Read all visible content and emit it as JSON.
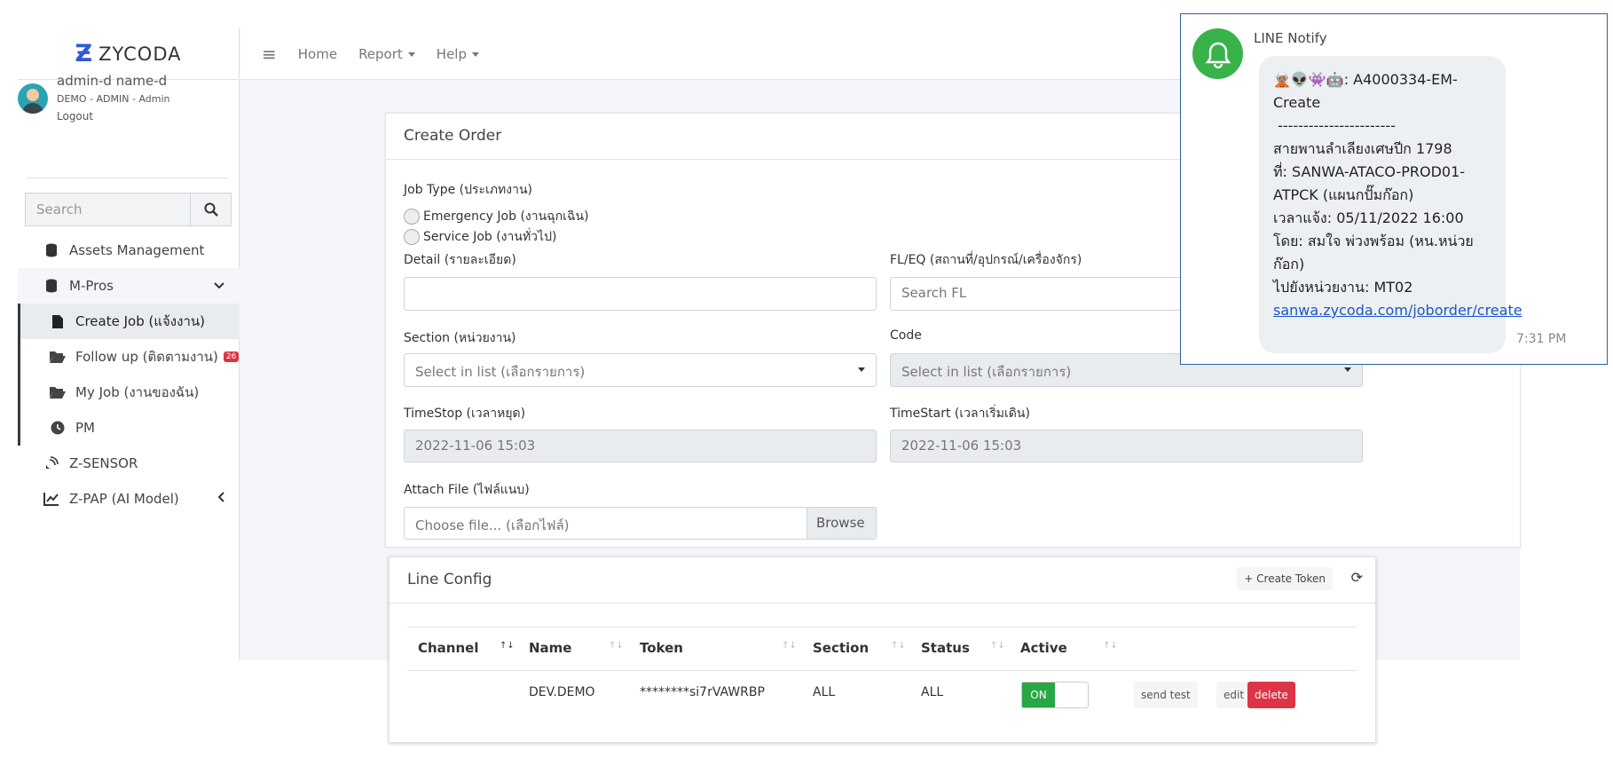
{
  "brand": {
    "name": "ZYCODA"
  },
  "user": {
    "name": "admin-d name-d",
    "role": "DEMO - ADMIN - Admin",
    "logout": "Logout"
  },
  "search": {
    "placeholder": "Search"
  },
  "nav": [
    {
      "label": "Assets Management",
      "icon": "database-icon"
    },
    {
      "label": "M-Pros",
      "icon": "database-icon"
    },
    {
      "label": "Create Job (แจ้งงาน)",
      "icon": "file-icon"
    },
    {
      "label": "Follow up (ติดตามงาน)",
      "icon": "folder-open-icon",
      "badge": "26"
    },
    {
      "label": "My Job (งานของฉัน)",
      "icon": "folder-open-icon"
    },
    {
      "label": "PM",
      "icon": "clock-icon"
    },
    {
      "label": "Z-SENSOR",
      "icon": "satellite-dish-icon"
    },
    {
      "label": "Z-PAP (AI Model)",
      "icon": "chart-line-icon"
    }
  ],
  "topnav": {
    "home": "Home",
    "report": "Report",
    "help": "Help"
  },
  "order": {
    "title": "Create Order",
    "job_type": "Job Type (ประเภทงาน)",
    "emergency": "Emergency Job (งานฉุกเฉิน)",
    "service": "Service Job (งานทั่วไป)",
    "detail": "Detail (รายละเอียด)",
    "fleq": "FL/EQ (สถานที่/อุปกรณ์/เครื่องจักร)",
    "fl_placeholder": "Search FL",
    "section": "Section (หน่วยงาน)",
    "section_value": "Select in list (เลือกรายการ)",
    "code": "Code",
    "code_value": "Select in list (เลือกรายการ)",
    "timestop": "TimeStop (เวลาหยุด)",
    "timestop_value": "2022-11-06 15:03",
    "timestart": "TimeStart (เวลาเริ่มเดิน)",
    "timestart_value": "2022-11-06 15:03",
    "attach": "Attach File (ไฟล์แนบ)",
    "file_placeholder": "Choose file... (เลือกไฟล์)",
    "browse": "Browse"
  },
  "line_config": {
    "title": "Line Config",
    "create_token": "+ Create Token",
    "columns": [
      "Channel",
      "Name",
      "Token",
      "Section",
      "Status",
      "Active"
    ],
    "row": {
      "channel": "",
      "name": "DEV.DEMO",
      "token": "********si7rVAWRBP",
      "section": "ALL",
      "status": "ALL",
      "active": "ON"
    },
    "send_test": "send test",
    "edit": "edit",
    "delete": "delete"
  },
  "notification": {
    "sender": "LINE Notify",
    "message": "🧝🏽👽👾🤖: A4000334-EM-Create\n -----------------------\nสายพานลำเลียงเศษปีก 1798\nที่: SANWA-ATACO-PROD01-ATPCK (แผนกปั๊มก๊อก)\nเวลาแจ้ง: 05/11/2022 16:00\nโดย: สมใจ พ่วงพร้อม (หน.หน่วยก๊อก)\nไปยังหน่วยงาน: MT02",
    "link": "sanwa.zycoda.com/joborder/create",
    "time": "7:31 PM"
  }
}
